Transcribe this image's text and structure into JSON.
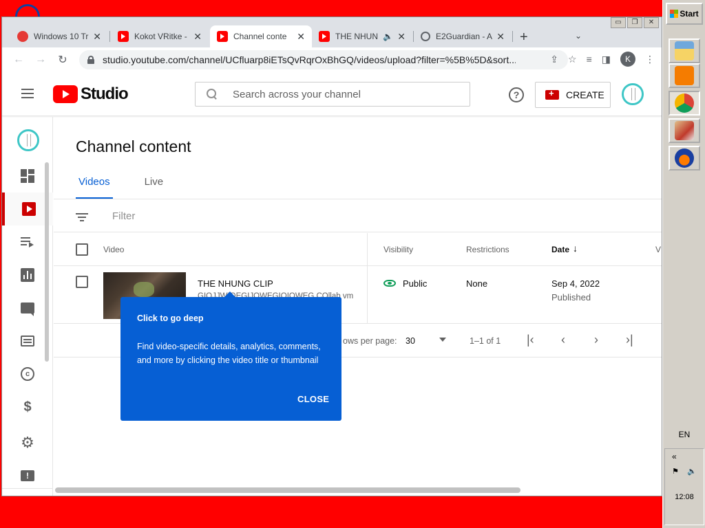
{
  "browser": {
    "tabs": [
      {
        "title": "Windows 10 Tr",
        "icon": "site-icon"
      },
      {
        "title": "Kokot VRitke - ",
        "icon": "youtube-icon"
      },
      {
        "title": "Channel conte",
        "icon": "youtube-icon",
        "active": true
      },
      {
        "title": "THE NHUN",
        "icon": "youtube-icon",
        "audio": true
      },
      {
        "title": "E2Guardian - A",
        "icon": "globe-icon"
      }
    ],
    "url": "studio.youtube.com/channel/UCfluarp8iETsQvRqrOxBhGQ/videos/upload?filter=%5B%5D&sort...",
    "profile_initial": "K"
  },
  "studio": {
    "logo_text": "Studio",
    "search_placeholder": "Search across your channel",
    "create_label": "CREATE",
    "page_title": "Channel content",
    "tabs": [
      "Videos",
      "Live"
    ],
    "filter_placeholder": "Filter",
    "columns": {
      "video": "Video",
      "visibility": "Visibility",
      "restrictions": "Restrictions",
      "date": "Date",
      "views": "V"
    },
    "rows": [
      {
        "title": "THE NHUNG CLIP",
        "description": "GIOJJWIOEGIJOWEGIOIOWEG COllab vm",
        "visibility": "Public",
        "restrictions": "None",
        "date": "Sep 4, 2022",
        "date_status": "Published"
      }
    ],
    "pagination": {
      "rows_per_page_label": "ows per page:",
      "rows_per_page": "30",
      "range": "1–1 of 1"
    },
    "callout": {
      "title": "Click to go deep",
      "body": "Find video-specific details, analytics, comments, and more by clicking the video title or thumbnail",
      "close_label": "CLOSE"
    }
  },
  "taskbar": {
    "start_label": "Start",
    "language": "EN",
    "clock": "12:08",
    "tray_chevron": "«"
  },
  "colors": {
    "accent": "#065fd4",
    "youtube_red": "#ff0000",
    "public_green": "#0f9d58",
    "desktop": "#ff0000"
  }
}
